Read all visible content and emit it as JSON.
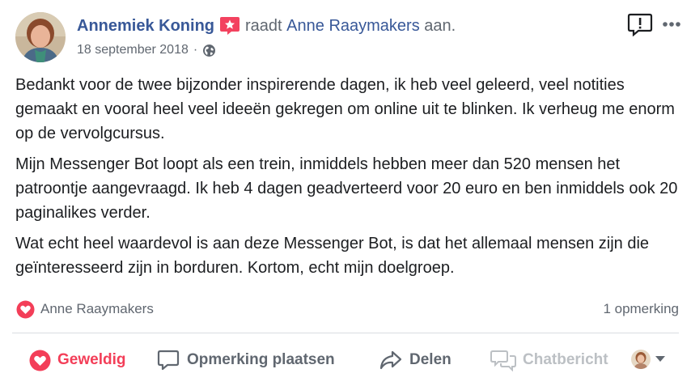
{
  "post": {
    "author": "Annemiek Koning",
    "verb": "raadt",
    "page": "Anne Raaymakers",
    "verb_suffix": "aan.",
    "date": "18 september 2018",
    "separator": "·",
    "audience_icon": "globe-icon",
    "paragraphs": [
      "Bedankt voor de twee bijzonder inspirerende dagen, ik heb veel geleerd, veel notities gemaakt en vooral heel veel ideeën gekregen om online uit te blinken. Ik verheug me enorm op de vervolgcursus.",
      "Mijn Messenger Bot loopt als een trein, inmiddels hebben meer dan 520 mensen het patroontje aangevraagd. Ik heb 4 dagen geadverteerd voor 20 euro en ben inmiddels ook 20 paginalikes verder.",
      "Wat echt heel waardevol is aan deze Messenger Bot, is dat het allemaal mensen zijn die geïnteresseerd zijn in borduren. Kortom, echt mijn doelgroep."
    ]
  },
  "reactions": {
    "label": "Anne Raaymakers",
    "icon": "heart-icon",
    "comments": "1 opmerking"
  },
  "actions": {
    "like": "Geweldig",
    "comment": "Opmerking plaatsen",
    "share": "Delen",
    "chat": "Chatbericht"
  },
  "colors": {
    "link": "#385898",
    "muted": "#606770",
    "love": "#f33e58",
    "badge": "#f3425f",
    "disabled": "#bcc0c4",
    "divider": "#dadde1"
  }
}
